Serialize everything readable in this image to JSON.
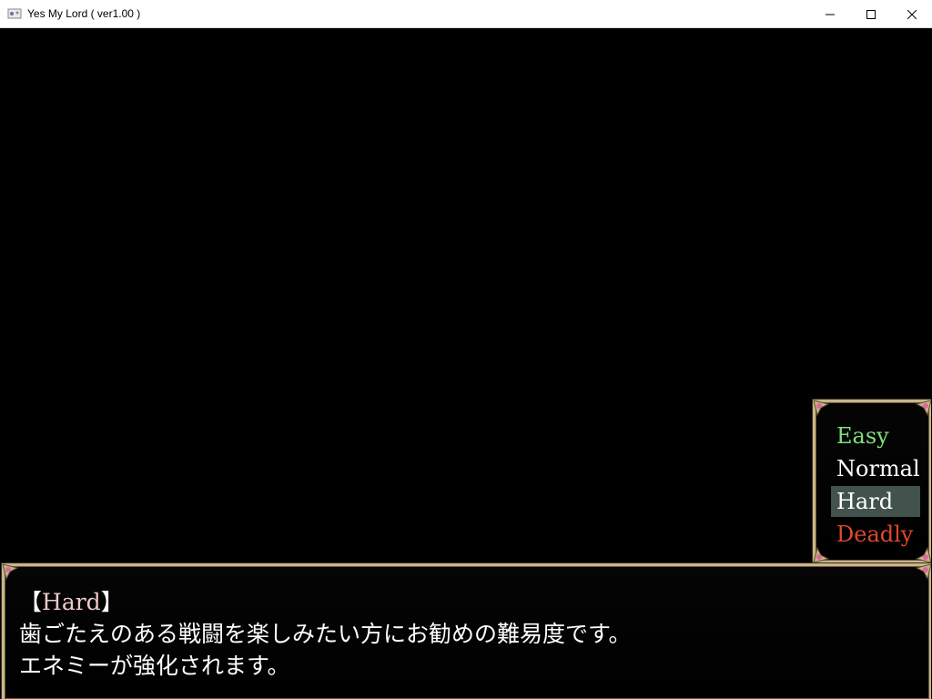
{
  "window": {
    "title": "Yes My Lord ( ver1.00 )",
    "app_icon": "game-app-icon",
    "controls": {
      "minimize_icon": "minimize-icon",
      "maximize_icon": "maximize-icon",
      "close_icon": "close-icon"
    }
  },
  "difficulty_menu": {
    "items": [
      {
        "label": "Easy",
        "color": "#7ee07a"
      },
      {
        "label": "Normal",
        "color": "#ffffff"
      },
      {
        "label": "Hard",
        "color": "#ffffff"
      },
      {
        "label": "Deadly",
        "color": "#e0482a"
      }
    ],
    "selected": "Hard"
  },
  "message": {
    "bracket_open": "【",
    "heading": "Hard",
    "bracket_close": "】",
    "heading_color": "#f0c8c8",
    "line1": "歯ごたえのある戦闘を楽しみたい方にお勧めの難易度です。",
    "line2": "エネミーが強化されます。"
  },
  "colors": {
    "frame": "#c9b58a",
    "corner_gem": "#d96aa0",
    "selection_bg": "#4d6b63"
  }
}
